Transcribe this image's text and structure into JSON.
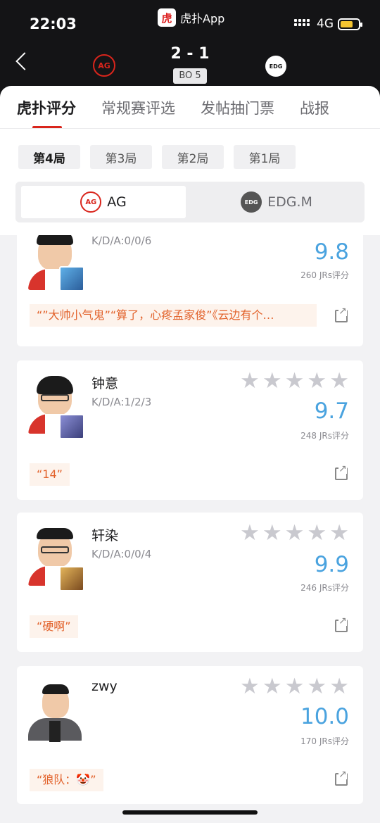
{
  "status_bar": {
    "time": "22:03",
    "app": "虎扑App",
    "network": "4G",
    "battery_fraction": 0.72
  },
  "match": {
    "score": "2 - 1",
    "format": "BO 5",
    "home_logo": "AG",
    "away_logo": "EDG"
  },
  "tabs": [
    {
      "label": "虎扑评分",
      "active": true
    },
    {
      "label": "常规赛评选",
      "active": false
    },
    {
      "label": "发帖抽门票",
      "active": false
    },
    {
      "label": "战报",
      "active": false
    }
  ],
  "games": [
    {
      "label": "第4局",
      "active": true
    },
    {
      "label": "第3局",
      "active": false
    },
    {
      "label": "第2局",
      "active": false
    },
    {
      "label": "第1局",
      "active": false
    }
  ],
  "team_toggle": {
    "home": "AG",
    "away": "EDG.M",
    "selected": "AG"
  },
  "players": [
    {
      "name": "",
      "kda": "K/D/A:0/0/6",
      "score": "9.8",
      "votes": "260 JRs评分",
      "quote": "“”大帅小气鬼”“算了，心疼孟家俊”《云边有个…",
      "stars": 0
    },
    {
      "name": "钟意",
      "kda": "K/D/A:1/2/3",
      "score": "9.7",
      "votes": "248 JRs评分",
      "quote": "“14”",
      "stars": 0
    },
    {
      "name": "轩染",
      "kda": "K/D/A:0/0/4",
      "score": "9.9",
      "votes": "246 JRs评分",
      "quote": "“硬啊”",
      "stars": 0
    },
    {
      "name": "zwy",
      "kda": "",
      "score": "10.0",
      "votes": "170 JRs评分",
      "quote": "“狼队：🤡”",
      "stars": 0
    }
  ],
  "colors": {
    "accent": "#d9251c",
    "score_blue": "#4aa3df",
    "quote_orange": "#e2622b"
  }
}
